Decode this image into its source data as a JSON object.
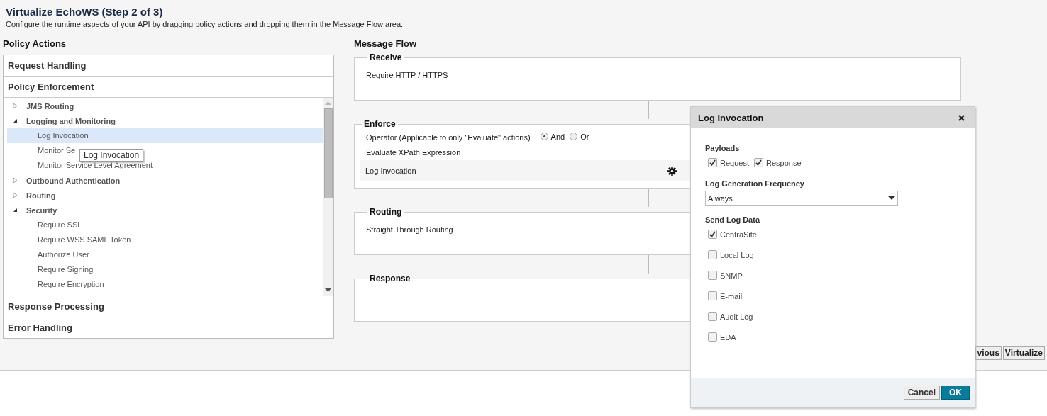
{
  "header": {
    "title": "Virtualize EchoWS (Step 2 of 3)",
    "subtitle": "Configure the runtime aspects of your API by dragging policy actions and dropping them in the Message Flow area."
  },
  "policy_actions": {
    "title": "Policy Actions",
    "sections_before": [
      {
        "label": "Request Handling"
      },
      {
        "label": "Policy Enforcement"
      }
    ],
    "tree": [
      {
        "label": "JMS Routing",
        "expanded": false
      },
      {
        "label": "Logging and Monitoring",
        "expanded": true,
        "children": [
          {
            "label": "Log Invocation",
            "selected": true
          },
          {
            "label": "Monitor Se",
            "selected": false
          },
          {
            "label": "Monitor Service Level Agreement",
            "selected": false
          }
        ]
      },
      {
        "label": "Outbound Authentication",
        "expanded": false
      },
      {
        "label": "Routing",
        "expanded": false
      },
      {
        "label": "Security",
        "expanded": true,
        "children": [
          {
            "label": "Require SSL",
            "selected": false
          },
          {
            "label": "Require WSS SAML Token",
            "selected": false
          },
          {
            "label": "Authorize User",
            "selected": false
          },
          {
            "label": "Require Signing",
            "selected": false
          },
          {
            "label": "Require Encryption",
            "selected": false
          }
        ]
      }
    ],
    "tooltip": "Log Invocation",
    "sections_after": [
      {
        "label": "Response Processing"
      },
      {
        "label": "Error Handling"
      }
    ]
  },
  "message_flow": {
    "title": "Message Flow",
    "stages": [
      {
        "kind": "plain",
        "legend": "Receive",
        "items": [
          "Require HTTP / HTTPS"
        ]
      },
      {
        "kind": "enforce",
        "legend": "Enforce",
        "operator_label": "Operator (Applicable to only \"Evaluate\" actions)",
        "operators": [
          {
            "label": "And",
            "selected": true
          },
          {
            "label": "Or",
            "selected": false
          }
        ],
        "items": [
          "Evaluate XPath Expression"
        ],
        "active_item": "Log Invocation"
      },
      {
        "kind": "plain",
        "legend": "Routing",
        "items": [
          "Straight Through Routing"
        ]
      },
      {
        "kind": "plain",
        "legend": "Response"
      }
    ]
  },
  "footer_buttons": [
    "vious",
    "Virtualize"
  ],
  "dialog": {
    "title": "Log Invocation",
    "payloads": {
      "label": "Payloads",
      "options": [
        {
          "label": "Request",
          "checked": true
        },
        {
          "label": "Response",
          "checked": true
        }
      ]
    },
    "frequency": {
      "label": "Log Generation Frequency",
      "value": "Always"
    },
    "send": {
      "label": "Send Log Data",
      "options": [
        {
          "label": "CentraSite",
          "checked": true
        },
        {
          "label": "Local Log",
          "checked": false
        },
        {
          "label": "SNMP",
          "checked": false
        },
        {
          "label": "E-mail",
          "checked": false
        },
        {
          "label": "Audit Log",
          "checked": false
        },
        {
          "label": "EDA",
          "checked": false
        }
      ]
    },
    "buttons": {
      "cancel": "Cancel",
      "ok": "OK"
    }
  }
}
